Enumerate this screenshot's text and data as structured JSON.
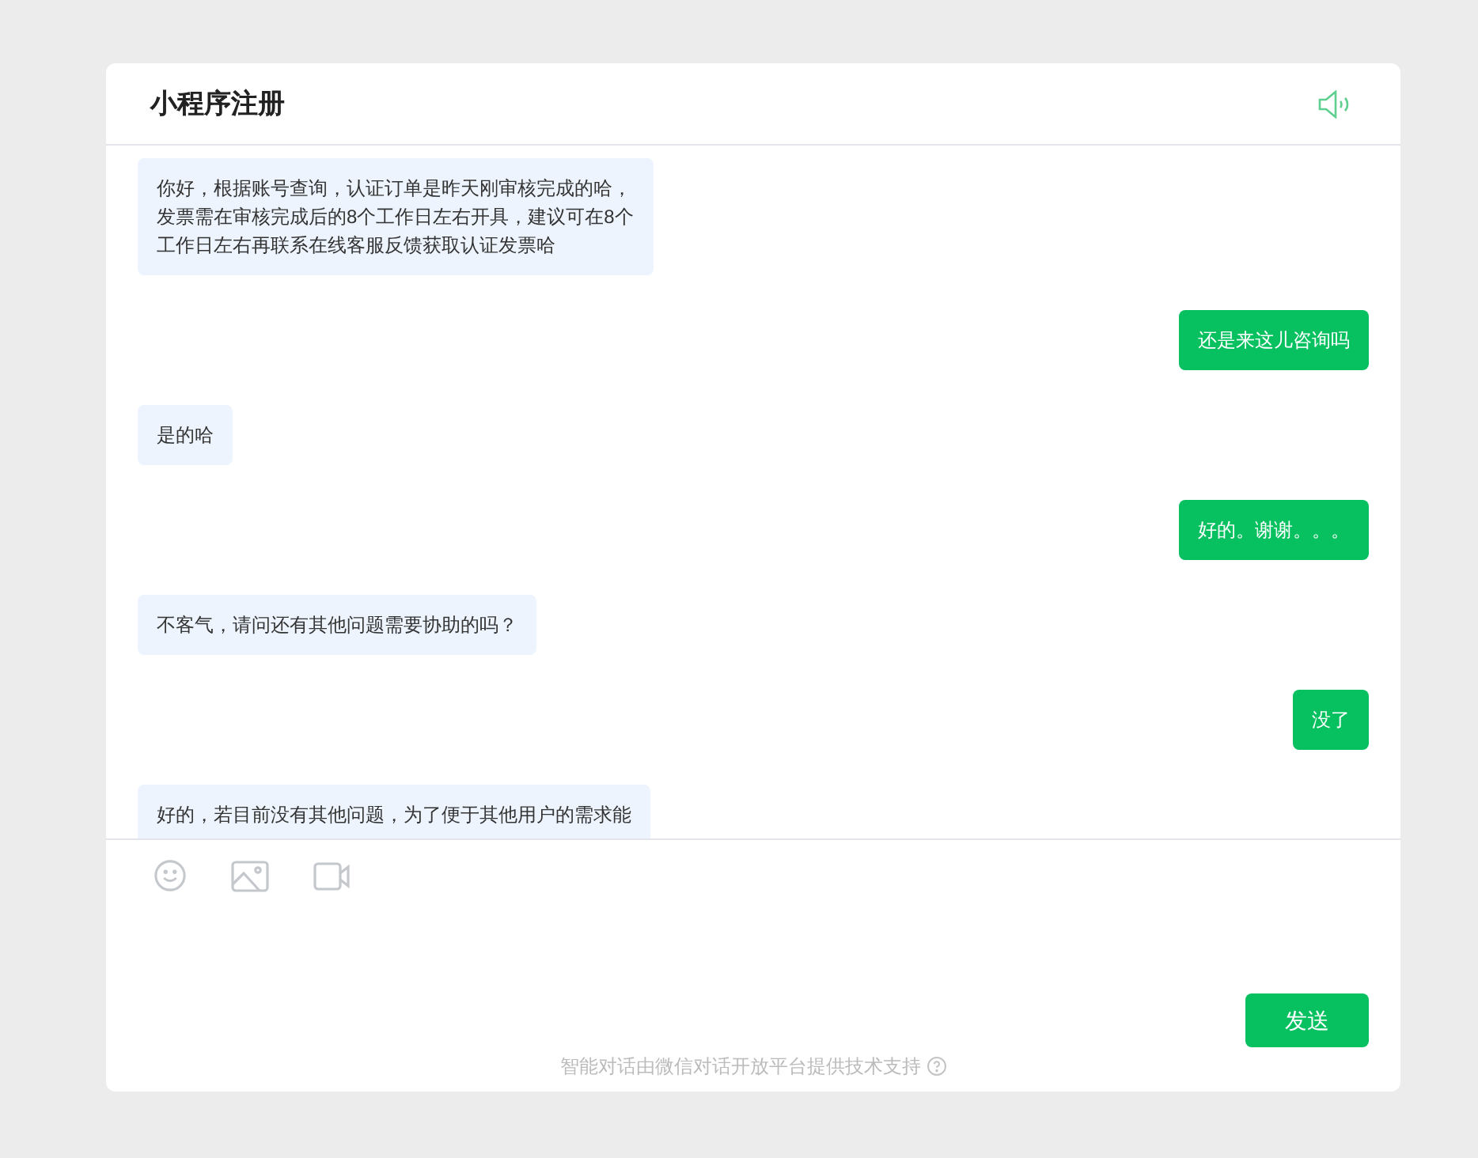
{
  "window": {
    "title": "小程序注册"
  },
  "messages": [
    {
      "kind": "received",
      "text": "你好，根据账号查询，认证订单是昨天刚审核完成的哈，发票需在审核完成后的8个工作日左右开具，建议可在8个工作日左右再联系在线客服反馈获取认证发票哈"
    },
    {
      "kind": "sent",
      "text": "还是来这儿咨询吗"
    },
    {
      "kind": "received",
      "text": "是的哈"
    },
    {
      "kind": "sent",
      "text": "好的。谢谢。。。"
    },
    {
      "kind": "received",
      "text": "不客气，请问还有其他问题需要协助的吗？"
    },
    {
      "kind": "sent",
      "text": "没了"
    },
    {
      "kind": "received",
      "text": "好的，若目前没有其他问题，为了便于其他用户的需求能"
    }
  ],
  "send_button": "发送",
  "footer": "智能对话由微信对话开放平台提供技术支持"
}
